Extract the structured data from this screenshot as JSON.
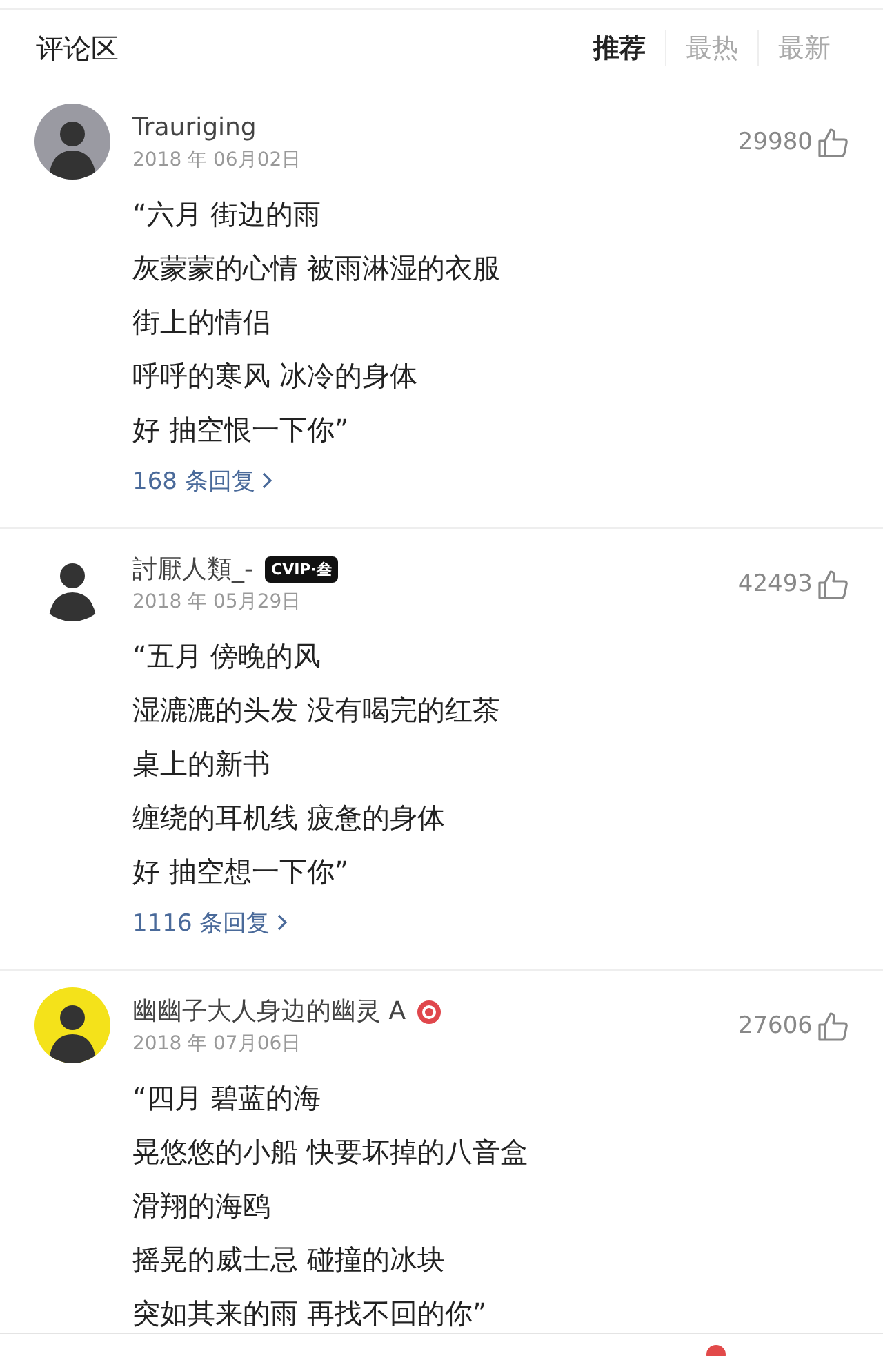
{
  "header": {
    "title": "评论区"
  },
  "tabs": [
    {
      "label": "推荐",
      "selected": true
    },
    {
      "label": "最热",
      "selected": false
    },
    {
      "label": "最新",
      "selected": false
    }
  ],
  "comments": [
    {
      "user": "Trauriging",
      "date": "2018 年 06月02日",
      "likes": "29980",
      "lines": [
        "“六月 街边的雨",
        "灰蒙蒙的心情 被雨淋湿的衣服",
        "街上的情侣",
        "呼呼的寒风 冰冷的身体",
        "好 抽空恨一下你”"
      ],
      "replies": "168 条回复"
    },
    {
      "user": "討厭人類_-",
      "date": "2018 年 05月29日",
      "likes": "42493",
      "badge": {
        "kind": "vip",
        "text": "CVIP·叁"
      },
      "lines": [
        "“五月 傍晚的风",
        "湿漉漉的头发 没有喝完的红茶",
        "桌上的新书",
        "缠绕的耳机线 疲惫的身体",
        "好 抽空想一下你”"
      ],
      "replies": "1116 条回复"
    },
    {
      "user": "幽幽子大人身边的幽灵 A",
      "date": "2018 年 07月06日",
      "likes": "27606",
      "badge": {
        "kind": "disc"
      },
      "lines": [
        "“四月 碧蓝的海",
        "晃悠悠的小船 快要坏掉的八音盒",
        "滑翔的海鸥",
        "摇晃的威士忌 碰撞的冰块",
        "突如其来的雨 再找不回的你”"
      ]
    }
  ]
}
